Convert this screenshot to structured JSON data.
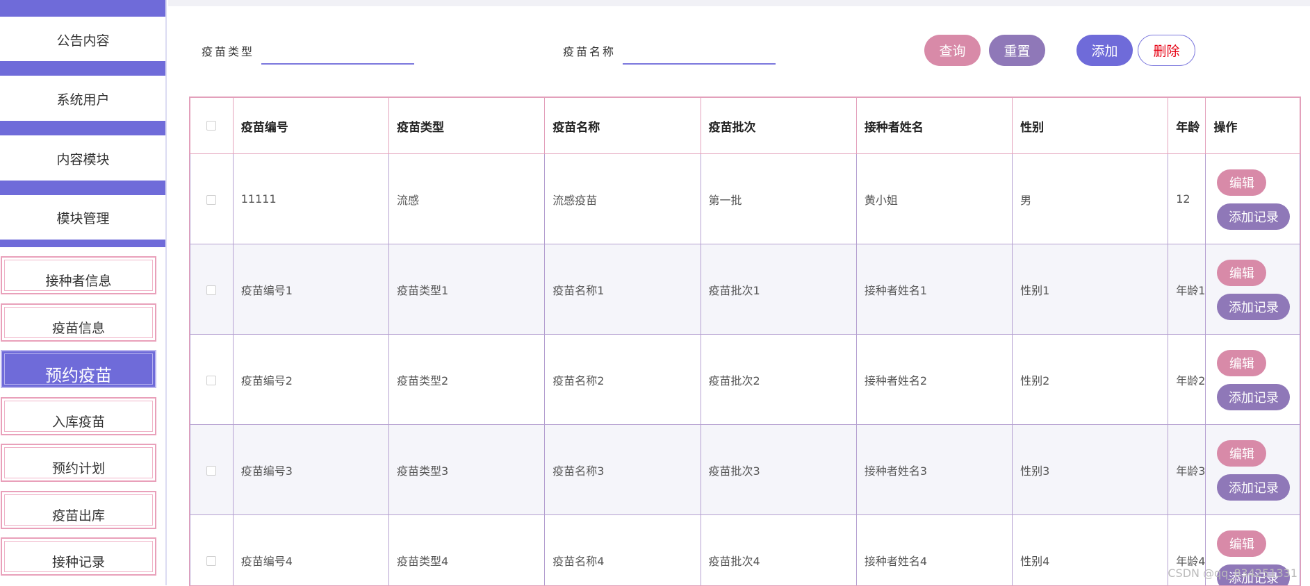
{
  "sidebar": {
    "top_items": [
      {
        "label": "公告内容"
      },
      {
        "label": "系统用户"
      },
      {
        "label": "内容模块"
      },
      {
        "label": "模块管理"
      }
    ],
    "sub_items": [
      {
        "label": "接种者信息",
        "active": false
      },
      {
        "label": "疫苗信息",
        "active": false
      },
      {
        "label": "预约疫苗",
        "active": true
      },
      {
        "label": "入库疫苗",
        "active": false
      },
      {
        "label": "预约计划",
        "active": false
      },
      {
        "label": "疫苗出库",
        "active": false
      },
      {
        "label": "接种记录",
        "active": false
      }
    ]
  },
  "filters": {
    "type_label": "疫苗类型",
    "type_value": "",
    "name_label": "疫苗名称",
    "name_value": ""
  },
  "buttons": {
    "query": "查询",
    "reset": "重置",
    "add": "添加",
    "delete": "删除"
  },
  "table": {
    "headers": [
      "疫苗编号",
      "疫苗类型",
      "疫苗名称",
      "疫苗批次",
      "接种者姓名",
      "性别",
      "年龄",
      "操作"
    ],
    "rows": [
      [
        "11111",
        "流感",
        "流感疫苗",
        "第一批",
        "黄小姐",
        "男",
        "12"
      ],
      [
        "疫苗编号1",
        "疫苗类型1",
        "疫苗名称1",
        "疫苗批次1",
        "接种者姓名1",
        "性别1",
        "年龄1"
      ],
      [
        "疫苗编号2",
        "疫苗类型2",
        "疫苗名称2",
        "疫苗批次2",
        "接种者姓名2",
        "性别2",
        "年龄2"
      ],
      [
        "疫苗编号3",
        "疫苗类型3",
        "疫苗名称3",
        "疫苗批次3",
        "接种者姓名3",
        "性别3",
        "年龄3"
      ],
      [
        "疫苗编号4",
        "疫苗类型4",
        "疫苗名称4",
        "疫苗批次4",
        "接种者姓名4",
        "性别4",
        "年龄4"
      ]
    ],
    "row_actions": {
      "edit": "编辑",
      "add_record": "添加记录"
    }
  },
  "watermark": "CSDN @qq_834251331",
  "colors": {
    "primary": "#6f6bd9",
    "query": "#d88aa8",
    "reset": "#8f78b8",
    "delete_text": "#e60012",
    "table_border": "#e3a0bb"
  }
}
